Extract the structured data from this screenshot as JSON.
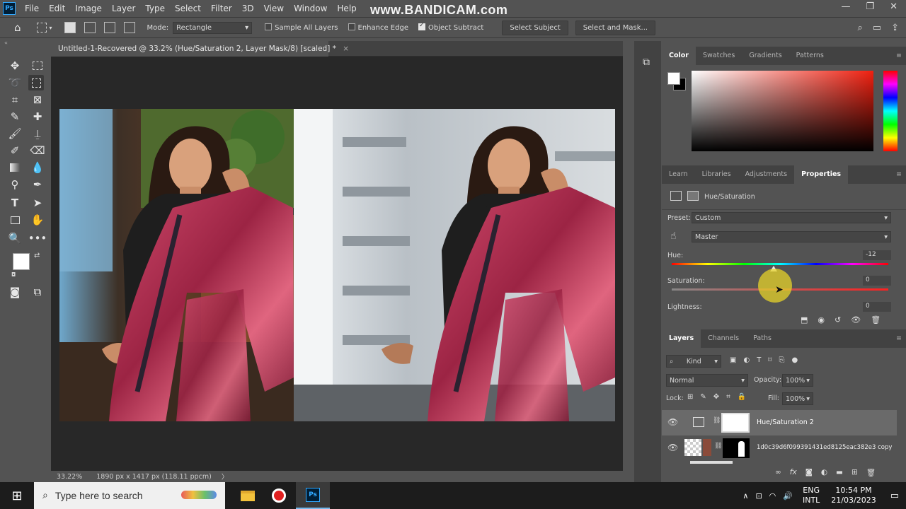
{
  "menu": {
    "logo": "Ps",
    "items": [
      "File",
      "Edit",
      "Image",
      "Layer",
      "Type",
      "Select",
      "Filter",
      "3D",
      "View",
      "Window",
      "Help"
    ]
  },
  "watermark": "www.BANDICAM.com",
  "options_bar": {
    "mode_label": "Mode:",
    "mode_value": "Rectangle",
    "sample_all_layers": "Sample All Layers",
    "enhance_edge": "Enhance Edge",
    "object_subtract": "Object Subtract",
    "select_subject": "Select Subject",
    "select_and_mask": "Select and Mask..."
  },
  "document": {
    "tab_title": "Untitled-1-Recovered @ 33.2% (Hue/Saturation 2, Layer Mask/8) [scaled] *",
    "close_glyph": "×",
    "zoom": "33.22%",
    "dimensions": "1890 px x 1417 px (118.11 ppcm)",
    "status_arrow": "〉"
  },
  "color_panel": {
    "tabs": [
      "Color",
      "Swatches",
      "Gradients",
      "Patterns"
    ],
    "active_tab": "Color"
  },
  "properties_panel": {
    "tabs": [
      "Learn",
      "Libraries",
      "Adjustments",
      "Properties"
    ],
    "active_tab": "Properties",
    "adjustment_name": "Hue/Saturation",
    "preset_label": "Preset:",
    "preset_value": "Custom",
    "channel_value": "Master",
    "hue_label": "Hue:",
    "hue_value": "-12",
    "hue_fraction": 0.472,
    "saturation_label": "Saturation:",
    "saturation_value": "0",
    "lightness_label": "Lightness:",
    "lightness_value": "0"
  },
  "layers_panel": {
    "tabs": [
      "Layers",
      "Channels",
      "Paths"
    ],
    "active_tab": "Layers",
    "filter_kind": "Kind",
    "blend_mode": "Normal",
    "opacity_label": "Opacity:",
    "opacity_value": "100%",
    "lock_label": "Lock:",
    "fill_label": "Fill:",
    "fill_value": "100%",
    "layers": [
      {
        "name": "Hue/Saturation 2"
      },
      {
        "name": "1d0c39d6f099391431ed8125eac382e3  copy"
      }
    ]
  },
  "taskbar": {
    "search_placeholder": "Type here to search",
    "lang_top": "ENG",
    "lang_bottom": "INTL",
    "time": "10:54 PM",
    "date": "21/03/2023"
  },
  "colors": {
    "ui_bg": "#535353",
    "panel_dark": "#424242",
    "canvas_bg": "#282828",
    "saree": "#b23a58",
    "accent": "#31a8ff"
  }
}
